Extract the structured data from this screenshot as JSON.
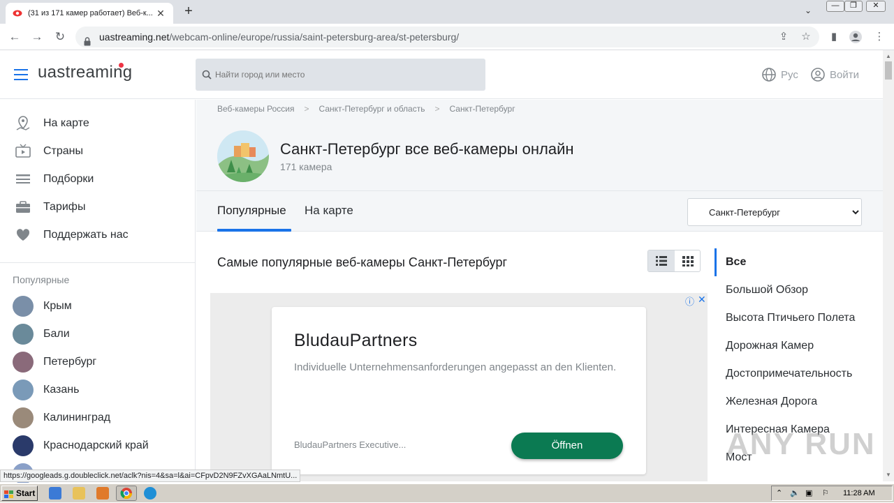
{
  "browser": {
    "tab_title": "(31 из 171 камер работает) Веб-к...",
    "tab_close": "✕",
    "new_tab": "+",
    "url_host": "uastreaming.net",
    "url_path": "/webcam-online/europe/russia/saint-petersburg-area/st-petersburg/",
    "status_link": "https://googleads.g.doubleclick.net/aclk?nis=4&sa=l&ai=CFpvD2N9FZvXGAaLNmtU..."
  },
  "site": {
    "logo": "uastreaming",
    "search_placeholder": "Найти город или место",
    "lang": "Рус",
    "login": "Войти"
  },
  "sidebar": {
    "nav": [
      {
        "label": "На карте",
        "icon": "map-pin-icon"
      },
      {
        "label": "Страны",
        "icon": "tv-icon"
      },
      {
        "label": "Подборки",
        "icon": "list-icon"
      },
      {
        "label": "Тарифы",
        "icon": "briefcase-icon"
      },
      {
        "label": "Поддержать нас",
        "icon": "heart-icon"
      }
    ],
    "popular_title": "Популярные",
    "popular": [
      {
        "label": "Крым",
        "color": "#7a8fa8"
      },
      {
        "label": "Бали",
        "color": "#6a8a9a"
      },
      {
        "label": "Петербург",
        "color": "#8a6a7a"
      },
      {
        "label": "Казань",
        "color": "#7a9ab8"
      },
      {
        "label": "Калининград",
        "color": "#9a8a7a"
      },
      {
        "label": "Краснодарский край",
        "color": "#2a3a6a"
      }
    ]
  },
  "main": {
    "breadcrumbs": [
      "Веб-камеры Россия",
      "Санкт-Петербург и область",
      "Санкт-Петербург"
    ],
    "breadcrumb_sep": ">",
    "title": "Санкт-Петербург все веб-камеры онлайн",
    "count": "171 камера",
    "tabs": [
      "Популярные",
      "На карте"
    ],
    "city_select": "Санкт-Петербург",
    "section_title": "Самые популярные веб-камеры Санкт-Петербург"
  },
  "ad": {
    "title": "BludauPartners",
    "text": "Individuelle Unternehmensanforderungen angepasst an den Klienten.",
    "source": "BludauPartners Executive...",
    "button": "Öffnen",
    "info": "ⓘ",
    "close": "✕"
  },
  "categories": [
    "Все",
    "Большой Обзор",
    "Высота Птичьего Полета",
    "Дорожная Камер",
    "Достопримечательность",
    "Железная Дорога",
    "Интересная Камера",
    "Мост"
  ],
  "watermark": "ANY RUN",
  "taskbar": {
    "start": "Start",
    "time": "11:28 AM"
  }
}
